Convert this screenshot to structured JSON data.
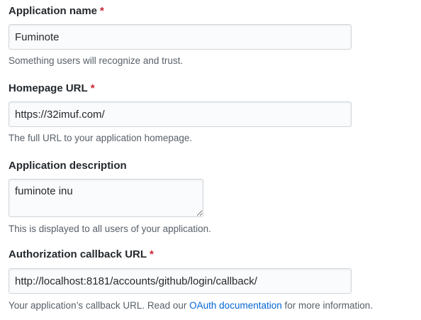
{
  "fields": {
    "app_name": {
      "label": "Application name",
      "required_mark": "*",
      "value": "Fuminote",
      "note": "Something users will recognize and trust."
    },
    "homepage_url": {
      "label": "Homepage URL",
      "required_mark": "*",
      "value": "https://32imuf.com/",
      "note": "The full URL to your application homepage."
    },
    "description": {
      "label": "Application description",
      "value": "fuminote inu",
      "note": "This is displayed to all users of your application."
    },
    "callback_url": {
      "label": "Authorization callback URL",
      "required_mark": "*",
      "value": "http://localhost:8181/accounts/github/login/callback/",
      "note_before": "Your application’s callback URL. Read our ",
      "note_link": "OAuth documentation",
      "note_after": " for more information."
    }
  },
  "colors": {
    "required": "#cb2431",
    "link": "#0366d6",
    "note_text": "#586069",
    "input_border": "#d1d5da"
  }
}
